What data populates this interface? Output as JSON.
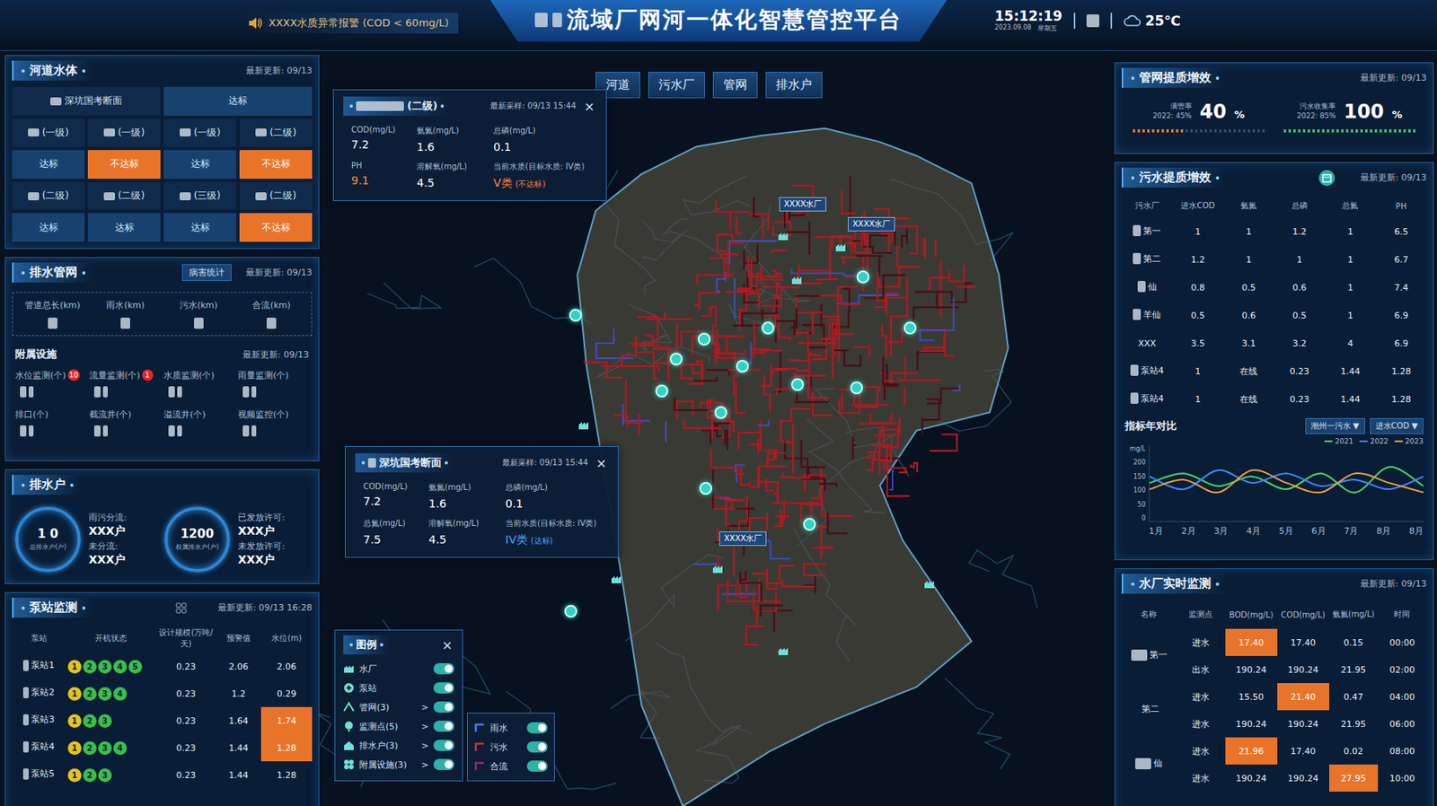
{
  "header": {
    "alert": "XXXX水质异常报警 (COD < 60mg/L)",
    "title": "流域厂网河一体化智慧管控平台",
    "time": "15:12:19",
    "date": "2023.09.08",
    "weekday": "星期五",
    "weather": "25℃"
  },
  "river": {
    "title": "河道水体",
    "updated": "最新更新: 09/13",
    "head": {
      "label": "深坑国考断面",
      "status": "达标",
      "pass": true
    },
    "stations": [
      {
        "label": "(一级)",
        "status": "达标",
        "pass": true
      },
      {
        "label": "(一级)",
        "status": "不达标",
        "pass": false
      },
      {
        "label": "(一级)",
        "status": "达标",
        "pass": true
      },
      {
        "label": "(二级)",
        "status": "不达标",
        "pass": false
      },
      {
        "label": "(二级)",
        "status": "达标",
        "pass": true
      },
      {
        "label": "(二级)",
        "status": "达标",
        "pass": true
      },
      {
        "label": "(三级)",
        "status": "达标",
        "pass": true
      },
      {
        "label": "(二级)",
        "status": "不达标",
        "pass": false
      }
    ]
  },
  "pipes": {
    "title": "排水管网",
    "button": "病害统计",
    "updated": "最新更新: 09/13",
    "stats": [
      "管道总长(km)",
      "雨水(km)",
      "污水(km)",
      "合流(km)"
    ],
    "facility_title": "附属设施",
    "facility_updated": "最新更新: 09/13",
    "facilities": [
      {
        "label": "水位监测(个)",
        "badge": "10"
      },
      {
        "label": "流量监测(个)",
        "badge": "1"
      },
      {
        "label": "水质监测(个)"
      },
      {
        "label": "雨量监测(个)"
      },
      {
        "label": "排口(个)"
      },
      {
        "label": "截流井(个)"
      },
      {
        "label": "溢流井(个)"
      },
      {
        "label": "视频监控(个)"
      }
    ]
  },
  "households": {
    "title": "排水户",
    "groups": [
      {
        "value": "1  0",
        "caption": "总排水户(户)",
        "rows": [
          {
            "label": "雨污分流:",
            "value": "XXX户"
          },
          {
            "label": "未分流:",
            "value": "XXX户"
          }
        ]
      },
      {
        "value": "1200",
        "caption": "权属排水户(户)",
        "rows": [
          {
            "label": "已发放许可:",
            "value": "XXX户"
          },
          {
            "label": "未发放许可:",
            "value": "XXX户"
          }
        ]
      }
    ]
  },
  "pump": {
    "title": "泵站监测",
    "updated": "最新更新: 09/13 16:28",
    "columns": [
      "泵站",
      "开机状态",
      "设计规模(万吨/天)",
      "预警值",
      "水位(m)"
    ],
    "rows": [
      {
        "name": "泵站1",
        "dots": [
          {
            "n": "1",
            "color": "#e6c41c"
          },
          {
            "n": "2",
            "color": "#3cbf4a"
          },
          {
            "n": "3",
            "color": "#3cbf4a"
          },
          {
            "n": "4",
            "color": "#3cbf4a"
          },
          {
            "n": "5",
            "color": "#3cbf4a"
          }
        ],
        "scale": "0.23",
        "warn_value": "2.06",
        "level": "2.06",
        "alert": false
      },
      {
        "name": "泵站2",
        "dots": [
          {
            "n": "1",
            "color": "#e6c41c"
          },
          {
            "n": "2",
            "color": "#3cbf4a"
          },
          {
            "n": "3",
            "color": "#3cbf4a"
          },
          {
            "n": "4",
            "color": "#3cbf4a"
          }
        ],
        "scale": "0.23",
        "warn_value": "1.2",
        "level": "0.29",
        "alert": false
      },
      {
        "name": "泵站3",
        "dots": [
          {
            "n": "1",
            "color": "#e6c41c"
          },
          {
            "n": "2",
            "color": "#3cbf4a"
          },
          {
            "n": "3",
            "color": "#3cbf4a"
          }
        ],
        "scale": "0.23",
        "warn_value": "1.64",
        "level": "1.74",
        "alert": true
      },
      {
        "name": "泵站4",
        "dots": [
          {
            "n": "1",
            "color": "#e6c41c"
          },
          {
            "n": "2",
            "color": "#3cbf4a"
          },
          {
            "n": "3",
            "color": "#3cbf4a"
          },
          {
            "n": "4",
            "color": "#3cbf4a"
          }
        ],
        "scale": "0.23",
        "warn_value": "1.44",
        "level": "1.28",
        "alert": true
      },
      {
        "name": "泵站5",
        "dots": [
          {
            "n": "1",
            "color": "#e6c41c"
          },
          {
            "n": "2",
            "color": "#3cbf4a"
          },
          {
            "n": "3",
            "color": "#3cbf4a"
          }
        ],
        "scale": "0.23",
        "warn_value": "1.44",
        "level": "1.28",
        "alert": false
      }
    ]
  },
  "map": {
    "tabs": [
      {
        "label": "河道",
        "selected": false
      },
      {
        "label": "污水厂",
        "selected": false
      },
      {
        "label": "管网",
        "selected": false
      },
      {
        "label": "排水户",
        "selected": false
      }
    ],
    "plants": [
      "XXXX水厂",
      "XXXX水厂",
      "XXXX水厂"
    ],
    "popups": [
      {
        "title": "(二级)",
        "sampled": "最新采样: 09/13 15:44",
        "close": "×",
        "metrics": [
          {
            "label": "COD(mg/L)",
            "value": "7.2",
            "alert": false
          },
          {
            "label": "氨氮(mg/L)",
            "value": "1.6",
            "alert": false
          },
          {
            "label": "总磷(mg/L)",
            "value": "0.1",
            "alert": false
          },
          {
            "label": "PH",
            "value": "9.1",
            "alert": true
          },
          {
            "label": "溶解氧(mg/L)",
            "value": "4.5",
            "alert": false
          }
        ],
        "quality_label": "当前水质(目标水质: IV类)",
        "quality": "V类",
        "quality_note": "(不达标)",
        "pass": false
      },
      {
        "title": "深坑国考断面",
        "sampled": "最新采样: 09/13 15:44",
        "close": "×",
        "metrics": [
          {
            "label": "COD(mg/L)",
            "value": "7.2",
            "alert": false
          },
          {
            "label": "氨氮(mg/L)",
            "value": "1.6",
            "alert": false
          },
          {
            "label": "总磷(mg/L)",
            "value": "0.1",
            "alert": false
          },
          {
            "label": "总氮(mg/L)",
            "value": "7.5",
            "alert": false
          },
          {
            "label": "溶解氧(mg/L)",
            "value": "4.5",
            "alert": false
          }
        ],
        "quality_label": "当前水质(目标水质: IV类)",
        "quality": "IV类",
        "quality_note": "(达标)",
        "pass": true
      }
    ],
    "legend": {
      "title": "图例",
      "close": "×",
      "items": [
        {
          "label": "水厂",
          "on": true
        },
        {
          "label": "泵站",
          "on": true
        },
        {
          "label": "管网(3)",
          "on": true,
          "more": ">"
        },
        {
          "label": "监测点(5)",
          "on": true,
          "more": ">"
        },
        {
          "label": "排水户(3)",
          "on": true,
          "more": ">"
        },
        {
          "label": "附属设施(3)",
          "on": true,
          "more": ">"
        }
      ],
      "pipe_types": [
        {
          "label": "雨水",
          "on": true,
          "color": "#4a7bff"
        },
        {
          "label": "污水",
          "on": true,
          "color": "#d0342c"
        },
        {
          "label": "合流",
          "on": true,
          "color": "#9a2a6a"
        }
      ]
    }
  },
  "pipe_quality": {
    "title": "管网提质增效",
    "updated": "最新更新: 09/13",
    "kpis": [
      {
        "label": "满管率",
        "sub": "2022: 45%",
        "value": "40",
        "unit": "%",
        "level": 0.4,
        "color": "#e8742a"
      },
      {
        "label": "污水收集率",
        "sub": "2022: 85%",
        "value": "100",
        "unit": "%",
        "level": 1,
        "color": "#35c26b"
      }
    ]
  },
  "sewage": {
    "title": "污水提质增效",
    "updated": "最新更新: 09/13",
    "columns": [
      "污水厂",
      "进水COD",
      "氨氮",
      "总磷",
      "总氮",
      "PH"
    ],
    "rows": [
      [
        "第一",
        "1",
        "1",
        "1.2",
        "1",
        "6.5"
      ],
      [
        "第二",
        "1.2",
        "1",
        "1",
        "1",
        "6.7"
      ],
      [
        "仙",
        "0.8",
        "0.5",
        "0.6",
        "1",
        "7.4"
      ],
      [
        "羊仙",
        "0.5",
        "0.6",
        "0.5",
        "1",
        "6.9"
      ],
      [
        "XXX",
        "3.5",
        "3.1",
        "3.2",
        "4",
        "6.9"
      ],
      [
        "泵站4",
        "1",
        "在线",
        "0.23",
        "1.44",
        "1.28"
      ],
      [
        "泵站4",
        "1",
        "在线",
        "0.23",
        "1.44",
        "1.28"
      ]
    ],
    "chart": {
      "title": "指标年对比",
      "selects": [
        "潮州一污水 ▼",
        "进水COD ▼"
      ],
      "unit": "mg/L",
      "yticks": [
        "200",
        "150",
        "100",
        "50",
        "0"
      ],
      "xticks": [
        "1月",
        "2月",
        "3月",
        "4月",
        "5月",
        "6月",
        "7月",
        "8月",
        "8月"
      ],
      "ymax": 200,
      "series": [
        {
          "name": "2021",
          "color": "#4cd964",
          "values": [
            120,
            150,
            110,
            140,
            100,
            150,
            90,
            170,
            110
          ]
        },
        {
          "name": "2022",
          "color": "#3a8cff",
          "values": [
            140,
            100,
            160,
            120,
            150,
            110,
            130,
            100,
            140
          ]
        },
        {
          "name": "2023",
          "color": "#f0a040",
          "values": [
            100,
            130,
            90,
            160,
            120,
            90,
            150,
            120,
            90
          ]
        }
      ]
    }
  },
  "monitor": {
    "title": "水厂实时监测",
    "updated": "最新更新: 09/13",
    "columns": [
      "名称",
      "监测点",
      "BOD(mg/L)",
      "COD(mg/L)",
      "氨氮(mg/L)",
      "时间"
    ],
    "plants": [
      {
        "name": "第一",
        "rows": [
          {
            "point": "进水",
            "cells": [
              {
                "v": "17.40",
                "alert": true
              },
              {
                "v": "17.40",
                "alert": false
              },
              {
                "v": "0.15",
                "alert": false
              }
            ],
            "time": "00:00"
          },
          {
            "point": "出水",
            "cells": [
              {
                "v": "190.24",
                "alert": false
              },
              {
                "v": "190.24",
                "alert": false
              },
              {
                "v": "21.95",
                "alert": false
              }
            ],
            "time": "02:00"
          }
        ]
      },
      {
        "name": "第二",
        "rows": [
          {
            "point": "进水",
            "cells": [
              {
                "v": "15.50",
                "alert": false
              },
              {
                "v": "21.40",
                "alert": true
              },
              {
                "v": "0.47",
                "alert": false
              }
            ],
            "time": "04:00"
          },
          {
            "point": "进水",
            "cells": [
              {
                "v": "190.24",
                "alert": false
              },
              {
                "v": "190.24",
                "alert": false
              },
              {
                "v": "21.95",
                "alert": false
              }
            ],
            "time": "06:00"
          }
        ]
      },
      {
        "name": "仙",
        "rows": [
          {
            "point": "进水",
            "cells": [
              {
                "v": "21.96",
                "alert": true
              },
              {
                "v": "17.40",
                "alert": false
              },
              {
                "v": "0.02",
                "alert": false
              }
            ],
            "time": "08:00"
          },
          {
            "point": "进水",
            "cells": [
              {
                "v": "190.24",
                "alert": false
              },
              {
                "v": "190.24",
                "alert": false
              },
              {
                "v": "27.95",
                "alert": true
              }
            ],
            "time": "10:00"
          }
        ]
      }
    ]
  }
}
